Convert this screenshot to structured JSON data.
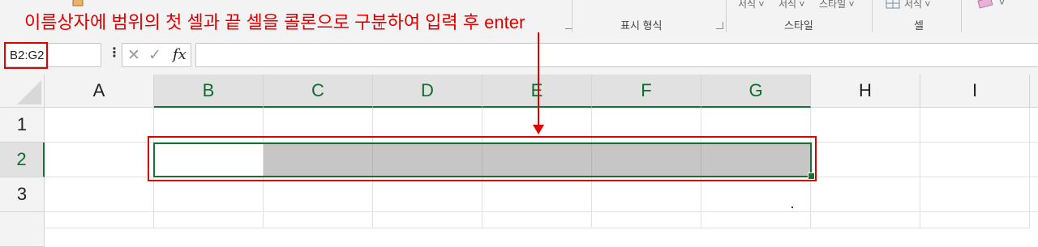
{
  "ribbon": {
    "groups": [
      {
        "label": "표시 형식"
      },
      {
        "label": "스타일"
      },
      {
        "label": "셀"
      }
    ],
    "top_buttons": [
      {
        "label": "서식 ˅"
      },
      {
        "label": "서식 ˅"
      },
      {
        "label": "스타일 ˅"
      },
      {
        "label": "서식 ˅"
      }
    ]
  },
  "formula_bar": {
    "name_box_value": "B2:G2",
    "more_glyph": "⋮",
    "cancel_glyph": "✕",
    "enter_glyph": "✓",
    "fx_label": "fx",
    "formula_value": ""
  },
  "grid": {
    "columns": [
      "A",
      "B",
      "C",
      "D",
      "E",
      "F",
      "G",
      "H",
      "I"
    ],
    "rows": [
      "1",
      "2",
      "3"
    ],
    "selected_range": "B2:G2",
    "active_cell": "B2"
  },
  "annotation": {
    "text": "이름상자에 범위의 첫 셀과 끝 셀을 콜론으로 구분하여 입력 후 enter",
    "color": "#e00000"
  },
  "colors": {
    "excel_green": "#137333",
    "highlight_gray": "#c6c6c6",
    "annotation_red": "#e00000"
  }
}
